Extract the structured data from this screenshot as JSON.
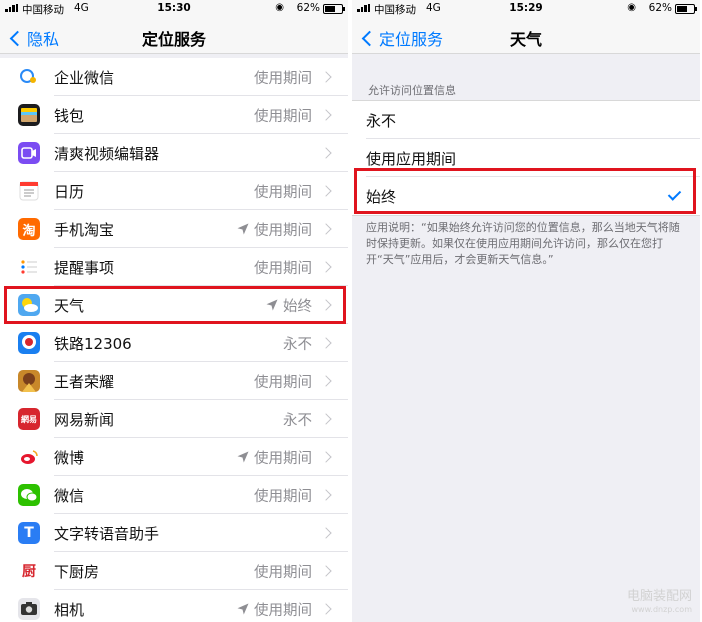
{
  "left": {
    "statusbar": {
      "carrier": "中国移动",
      "network": "4G",
      "time": "15:30",
      "battery": "62%",
      "battery_level": 0.62
    },
    "navbar": {
      "back_label": "隐私",
      "title": "定位服务"
    },
    "apps": [
      {
        "name": "企业微信",
        "status": "使用期间",
        "arrow": false,
        "icon": "wecom-icon",
        "color": "#ffffff"
      },
      {
        "name": "钱包",
        "status": "使用期间",
        "arrow": false,
        "icon": "wallet-icon",
        "color": "#1c1c1e"
      },
      {
        "name": "清爽视频编辑器",
        "status": "",
        "arrow": false,
        "icon": "video-editor-icon",
        "color": "#7b4cf2"
      },
      {
        "name": "日历",
        "status": "使用期间",
        "arrow": false,
        "icon": "calendar-icon",
        "color": "#ffffff"
      },
      {
        "name": "手机淘宝",
        "status": "使用期间",
        "arrow": true,
        "icon": "taobao-icon",
        "color": "#ff6a00"
      },
      {
        "name": "提醒事项",
        "status": "使用期间",
        "arrow": false,
        "icon": "reminders-icon",
        "color": "#ffffff"
      },
      {
        "name": "天气",
        "status": "始终",
        "arrow": true,
        "icon": "weather-icon",
        "color": "#4fa8f0"
      },
      {
        "name": "铁路12306",
        "status": "永不",
        "arrow": false,
        "icon": "railway-icon",
        "color": "#1a7ff0"
      },
      {
        "name": "王者荣耀",
        "status": "使用期间",
        "arrow": false,
        "icon": "honor-of-kings-icon",
        "color": "#c8882a"
      },
      {
        "name": "网易新闻",
        "status": "永不",
        "arrow": false,
        "icon": "netease-news-icon",
        "color": "#d7262e"
      },
      {
        "name": "微博",
        "status": "使用期间",
        "arrow": true,
        "icon": "weibo-icon",
        "color": "#ffffff"
      },
      {
        "name": "微信",
        "status": "使用期间",
        "arrow": false,
        "icon": "wechat-icon",
        "color": "#2dc100"
      },
      {
        "name": "文字转语音助手",
        "status": "",
        "arrow": false,
        "icon": "text-to-speech-icon",
        "color": "#2a7df4"
      },
      {
        "name": "下厨房",
        "status": "使用期间",
        "arrow": false,
        "icon": "xiachufang-icon",
        "color": "#ffffff"
      },
      {
        "name": "相机",
        "status": "使用期间",
        "arrow": true,
        "icon": "camera-icon",
        "color": "#e5e5ea"
      }
    ],
    "icon_glyphs": {
      "taobao": "淘",
      "netease": "網易",
      "xiachufang": "厨",
      "tts": "T"
    }
  },
  "right": {
    "statusbar": {
      "carrier": "中国移动",
      "network": "4G",
      "time": "15:29",
      "battery": "62%",
      "battery_level": 0.62
    },
    "navbar": {
      "back_label": "定位服务",
      "title": "天气"
    },
    "section_header": "允许访问位置信息",
    "options": [
      {
        "label": "永不",
        "selected": false
      },
      {
        "label": "使用应用期间",
        "selected": false
      },
      {
        "label": "始终",
        "selected": true
      }
    ],
    "footnote": "应用说明：“如果始终允许访问您的位置信息，那么当地天气将随时保持更新。如果仅在使用应用期间允许访问，那么仅在您打开“天气”应用后，才会更新天气信息。”"
  },
  "watermark": {
    "line1": "电脑装配网",
    "line2": "www.dnzp.com"
  },
  "colors": {
    "accent": "#007aff",
    "highlight": "#e0141e",
    "secondary_text": "#8e8e93"
  }
}
